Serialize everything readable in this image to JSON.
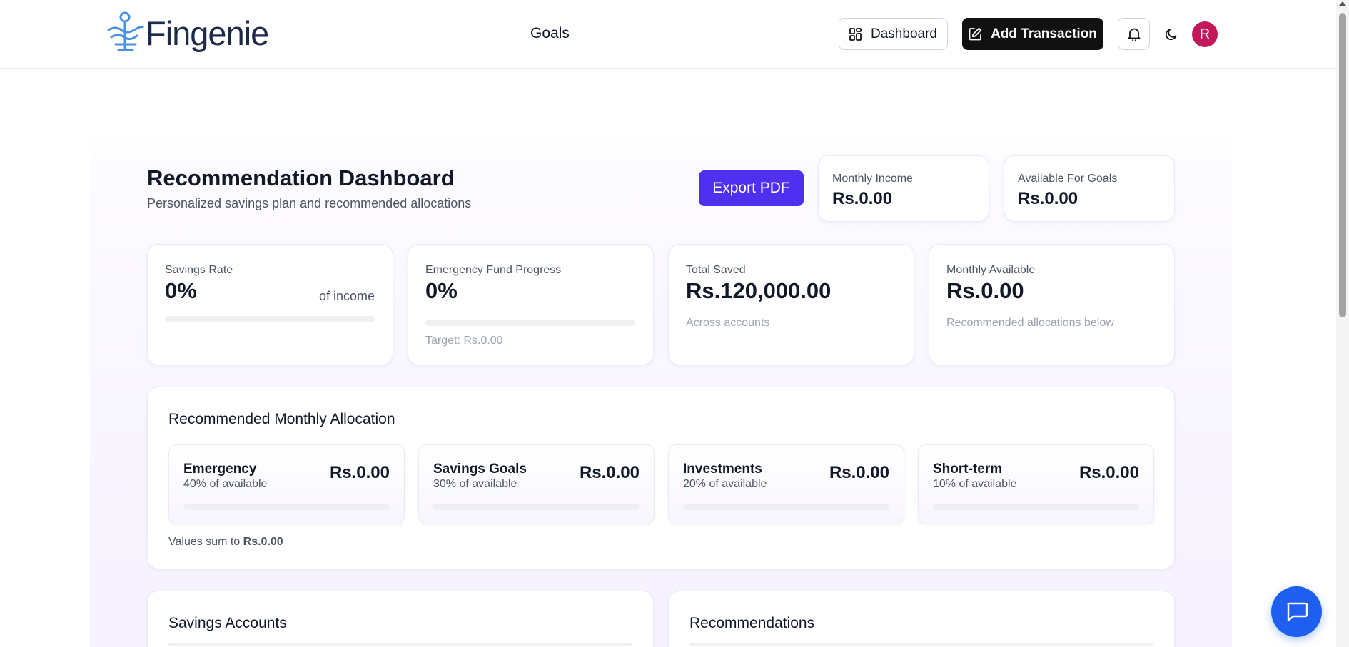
{
  "brand": {
    "name": "Fingenie",
    "accent": "#4f2ff0",
    "logo_color": "#4a90e2"
  },
  "header": {
    "nav_label": "Goals",
    "dashboard_label": "Dashboard",
    "add_transaction_label": "Add Transaction",
    "avatar_initial": "R",
    "avatar_color": "#c2185b"
  },
  "page": {
    "title": "Recommendation Dashboard",
    "subtitle": "Personalized savings plan and recommended allocations",
    "export_label": "Export PDF"
  },
  "summary": {
    "monthly_income": {
      "label": "Monthly Income",
      "value": "Rs.0.00"
    },
    "available_for_goals": {
      "label": "Available For Goals",
      "value": "Rs.0.00"
    }
  },
  "stats": {
    "savings_rate": {
      "label": "Savings Rate",
      "value": "0%",
      "suffix": "of income",
      "progress": 0
    },
    "emergency_fund": {
      "label": "Emergency Fund Progress",
      "value": "0%",
      "sub": "Target: Rs.0.00",
      "progress": 0
    },
    "total_saved": {
      "label": "Total Saved",
      "value": "Rs.120,000.00",
      "sub": "Across accounts"
    },
    "monthly_available": {
      "label": "Monthly Available",
      "value": "Rs.0.00",
      "sub": "Recommended allocations below"
    }
  },
  "allocation": {
    "title": "Recommended Monthly Allocation",
    "items": [
      {
        "name": "Emergency",
        "pct_label": "40% of available",
        "amount": "Rs.0.00",
        "progress": 0
      },
      {
        "name": "Savings Goals",
        "pct_label": "30% of available",
        "amount": "Rs.0.00",
        "progress": 0
      },
      {
        "name": "Investments",
        "pct_label": "20% of available",
        "amount": "Rs.0.00",
        "progress": 0
      },
      {
        "name": "Short-term",
        "pct_label": "10% of available",
        "amount": "Rs.0.00",
        "progress": 0
      }
    ],
    "sum_prefix": "Values sum to",
    "sum_value": "Rs.0.00"
  },
  "sections": {
    "savings_accounts_title": "Savings Accounts",
    "recommendations_title": "Recommendations"
  },
  "icons": {
    "dashboard": "grid-icon",
    "add_transaction": "edit-icon",
    "notifications": "bell-icon",
    "theme": "moon-icon",
    "chat": "chat-icon"
  }
}
